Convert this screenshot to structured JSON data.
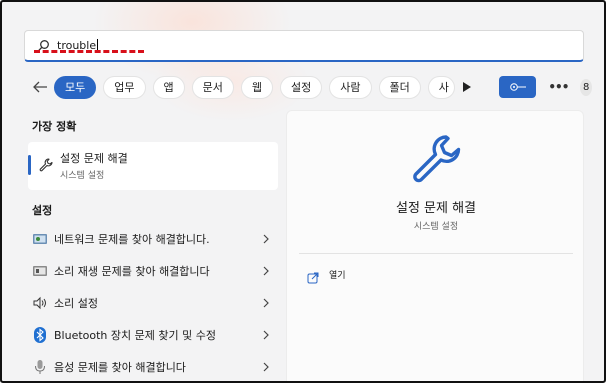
{
  "search": {
    "value": "trouble"
  },
  "filters": {
    "chips": [
      "모두",
      "업무",
      "앱",
      "문서",
      "웹",
      "설정",
      "사람",
      "폴더",
      "사"
    ],
    "active_index": 0,
    "result_count": "8"
  },
  "left": {
    "best_match_title": "가장 정확",
    "best_match": {
      "title": "설정 문제 해결",
      "subtitle": "시스템 설정"
    },
    "settings_title": "설정",
    "items": [
      {
        "label": "네트워크 문제를 찾아 해결합니다.",
        "icon": "network-troubleshoot-icon"
      },
      {
        "label": "소리 재생 문제를 찾아 해결합니다",
        "icon": "sound-playback-icon"
      },
      {
        "label": "소리 설정",
        "icon": "speaker-icon"
      },
      {
        "label": "Bluetooth 장치 문제 찾기 및 수정",
        "icon": "bluetooth-icon"
      },
      {
        "label": "음성 문제를 찾아 해결합니다",
        "icon": "microphone-icon"
      }
    ]
  },
  "detail": {
    "title": "설정 문제 해결",
    "subtitle": "시스템 설정",
    "open_label": "열기"
  },
  "colors": {
    "accent": "#2a66c4",
    "annotation": "#d8101a"
  }
}
